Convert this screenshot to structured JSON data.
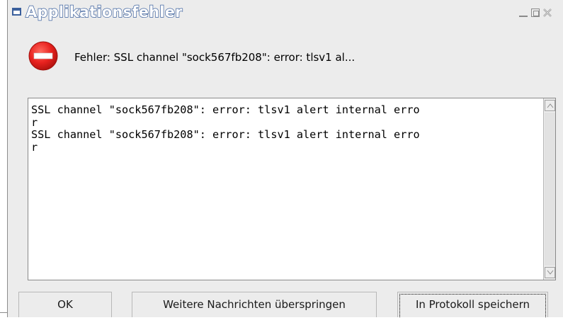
{
  "window": {
    "title": "Applikationsfehler",
    "controls": [
      "minimize-icon",
      "maximize-icon",
      "close-icon"
    ]
  },
  "error": {
    "icon": "error-stop-icon",
    "message": "Fehler: SSL channel \"sock567fb208\": error: tlsv1 al..."
  },
  "log": {
    "lines": [
      "SSL channel \"sock567fb208\": error: tlsv1 alert internal erro",
      "r",
      "SSL channel \"sock567fb208\": error: tlsv1 alert internal erro",
      "r"
    ]
  },
  "buttons": {
    "ok": "OK",
    "skip": "Weitere Nachrichten überspringen",
    "save_log": "In Protokoll speichern"
  },
  "colors": {
    "title_outline": "#3a5f9c",
    "error_red": "#e8221f",
    "dialog_bg": "#ececec"
  }
}
